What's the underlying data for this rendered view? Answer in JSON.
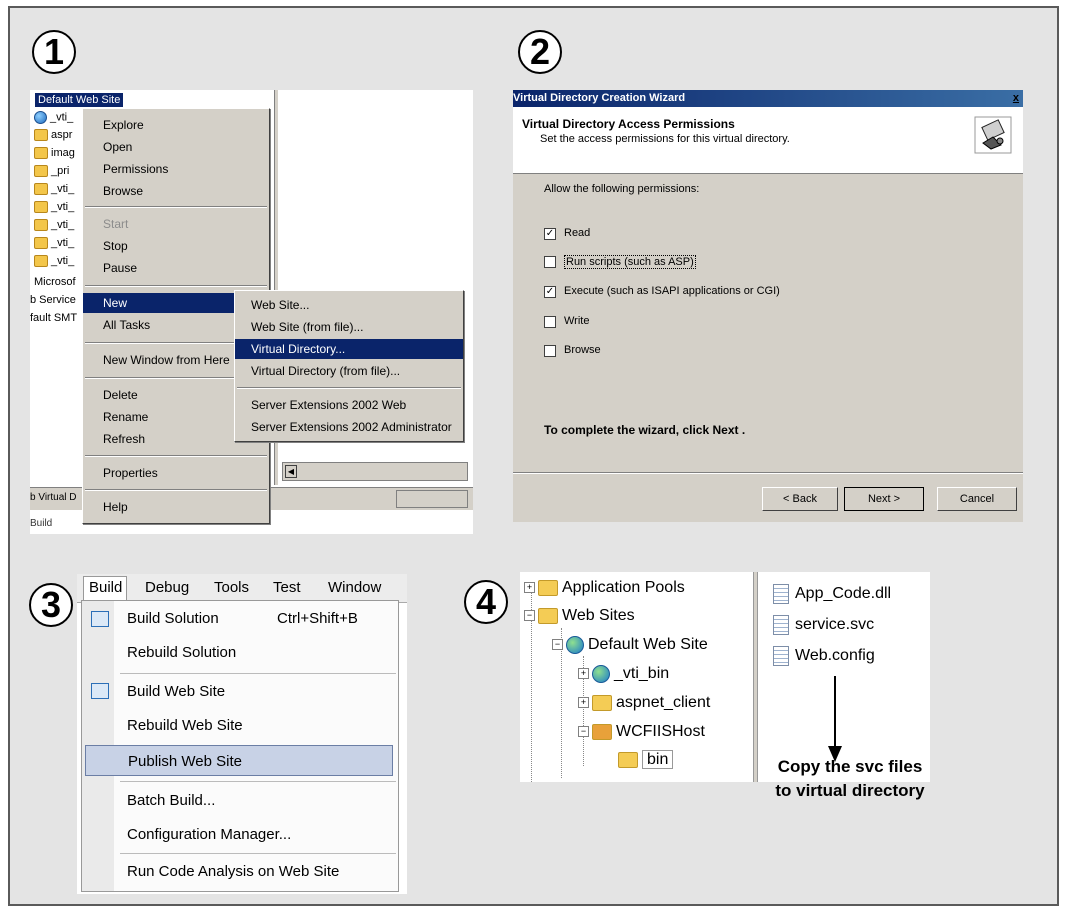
{
  "step_numbers": [
    "1",
    "2",
    "3",
    "4"
  ],
  "panel1": {
    "tree_selected": "Default Web Site",
    "tree_items": [
      "_vti_",
      "aspr",
      "imag",
      "_pri",
      "_vti_",
      "_vti_",
      "_vti_",
      "_vti_",
      "_vti_",
      "Microsof",
      "b Service",
      "fault SMT"
    ],
    "bottom_text_1": "b Virtual D",
    "bottom_text_2": "Build",
    "context_menu": [
      "Explore",
      "Open",
      "Permissions",
      "Browse",
      "Start",
      "Stop",
      "Pause",
      "New",
      "All Tasks",
      "New Window from Here",
      "Delete",
      "Rename",
      "Refresh",
      "Properties",
      "Help"
    ],
    "submenu": [
      "Web Site...",
      "Web Site (from file)...",
      "Virtual Directory...",
      "Virtual Directory (from file)...",
      "Server Extensions 2002 Web",
      "Server Extensions 2002 Administrator"
    ],
    "selected_menu": "New",
    "selected_submenu": "Virtual Directory..."
  },
  "panel2": {
    "title": "Virtual Directory Creation Wizard",
    "close_glyph": "x",
    "heading": "Virtual Directory Access Permissions",
    "subheading": "Set the access permissions for this virtual directory.",
    "allow_label": "Allow the following permissions:",
    "permissions": [
      {
        "label": "Read",
        "checked": true
      },
      {
        "label": "Run scripts (such as ASP)",
        "checked": false
      },
      {
        "label": "Execute (such as ISAPI applications or CGI)",
        "checked": true
      },
      {
        "label": "Write",
        "checked": false
      },
      {
        "label": "Browse",
        "checked": false
      }
    ],
    "completion_text": "To complete the wizard, click Next .",
    "back_button": "< Back",
    "next_button": "Next >",
    "cancel_button": "Cancel"
  },
  "panel3": {
    "menubar": [
      "Build",
      "Debug",
      "Tools",
      "Test",
      "Window"
    ],
    "menu_items": [
      "Build Solution",
      "Rebuild Solution",
      "Build Web Site",
      "Rebuild Web Site",
      "Publish Web Site",
      "Batch Build...",
      "Configuration Manager...",
      "Run Code Analysis on Web Site"
    ],
    "shortcut": "Ctrl+Shift+B",
    "selected_item": "Publish Web Site"
  },
  "panel4": {
    "tree": [
      "Application Pools",
      "Web Sites",
      "Default Web Site",
      "_vti_bin",
      "aspnet_client",
      "WCFIISHost",
      "bin"
    ],
    "files": [
      "App_Code.dll",
      "service.svc",
      "Web.config"
    ],
    "annotation": [
      "Copy the svc files",
      "to virtual directory"
    ]
  }
}
